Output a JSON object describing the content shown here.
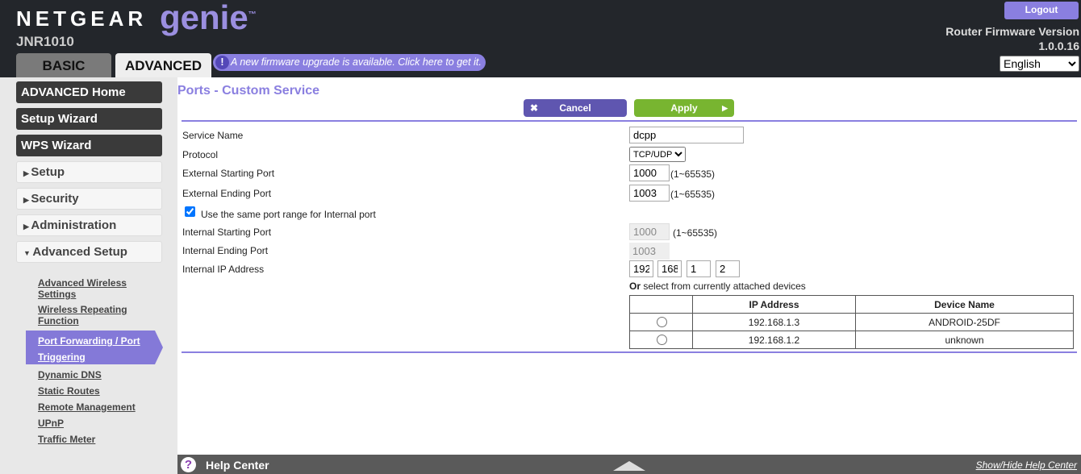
{
  "header": {
    "brand": "NETGEAR",
    "product": "genie",
    "tm": "™",
    "model": "JNR1010",
    "tabs": [
      {
        "label": "BASIC"
      },
      {
        "label": "ADVANCED"
      }
    ],
    "firmware_notice": "A new firmware upgrade is available. Click here to get it.",
    "logout": "Logout",
    "fw_label": "Router Firmware Version",
    "fw_version": "1.0.0.16",
    "language": "English"
  },
  "sidebar": {
    "top": [
      "ADVANCED Home",
      "Setup Wizard",
      "WPS Wizard"
    ],
    "sections": [
      "Setup",
      "Security",
      "Administration",
      "Advanced Setup"
    ],
    "sub": [
      "Advanced Wireless Settings",
      "Wireless Repeating Function",
      "Port Forwarding / Port Triggering",
      "Dynamic DNS",
      "Static Routes",
      "Remote Management",
      "UPnP",
      "Traffic Meter"
    ]
  },
  "main": {
    "title": "Ports - Custom Service",
    "cancel": "Cancel",
    "apply": "Apply",
    "labels": {
      "service_name": "Service Name",
      "protocol": "Protocol",
      "ext_start": "External Starting Port",
      "ext_end": "External Ending Port",
      "same_range": "Use the same port range for Internal port",
      "int_start": "Internal Starting Port",
      "int_end": "Internal Ending Port",
      "int_ip": "Internal IP Address",
      "or_select": "Or select from currently attached devices"
    },
    "values": {
      "service_name": "dcpp",
      "protocol": "TCP/UDP",
      "ext_start": "1000",
      "ext_end": "1003",
      "int_start": "1000",
      "int_end": "1003",
      "ip": [
        "192",
        "168",
        "1",
        "2"
      ],
      "range": "(1~65535)"
    },
    "table": {
      "headers": [
        "",
        "IP Address",
        "Device Name"
      ],
      "rows": [
        {
          "ip": "192.168.1.3",
          "name": "ANDROID-25DF"
        },
        {
          "ip": "192.168.1.2",
          "name": "unknown"
        }
      ]
    }
  },
  "help": {
    "title": "Help Center",
    "toggle": "Show/Hide Help Center"
  },
  "colors": {
    "accent": "#8a7fe0",
    "apply": "#78b530",
    "header": "#23262b"
  }
}
